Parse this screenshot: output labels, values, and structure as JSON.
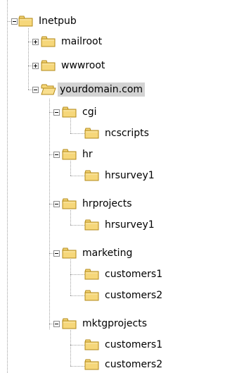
{
  "tree": {
    "root": {
      "label": "Inetpub",
      "state": "expanded"
    },
    "nodes": {
      "mailroot": {
        "label": "mailroot",
        "state": "collapsed"
      },
      "wwwroot": {
        "label": "wwwroot",
        "state": "collapsed"
      },
      "yourdomain": {
        "label": "yourdomain.com",
        "state": "expanded",
        "selected": true
      },
      "cgi": {
        "label": "cgi",
        "state": "expanded"
      },
      "ncscripts": {
        "label": "ncscripts"
      },
      "hr": {
        "label": "hr",
        "state": "expanded"
      },
      "hr_hrsurvey1": {
        "label": "hrsurvey1"
      },
      "hrprojects": {
        "label": "hrprojects",
        "state": "expanded"
      },
      "hrprojects_hrsurvey1": {
        "label": "hrsurvey1"
      },
      "marketing": {
        "label": "marketing",
        "state": "expanded"
      },
      "marketing_customers1": {
        "label": "customers1"
      },
      "marketing_customers2": {
        "label": "customers2"
      },
      "mktgprojects": {
        "label": "mktgprojects",
        "state": "expanded"
      },
      "mktgprojects_customers1": {
        "label": "customers1"
      },
      "mktgprojects_customers2": {
        "label": "customers2"
      }
    }
  },
  "colors": {
    "folder_fill": "#f6d77a",
    "folder_edge": "#b38a1a",
    "selection": "#d3d3d3",
    "connector": "#a0a0a0"
  },
  "icons": {
    "folder": "folder-icon",
    "open_folder": "open-folder-icon",
    "expand": "plus-icon",
    "collapse": "minus-icon"
  }
}
